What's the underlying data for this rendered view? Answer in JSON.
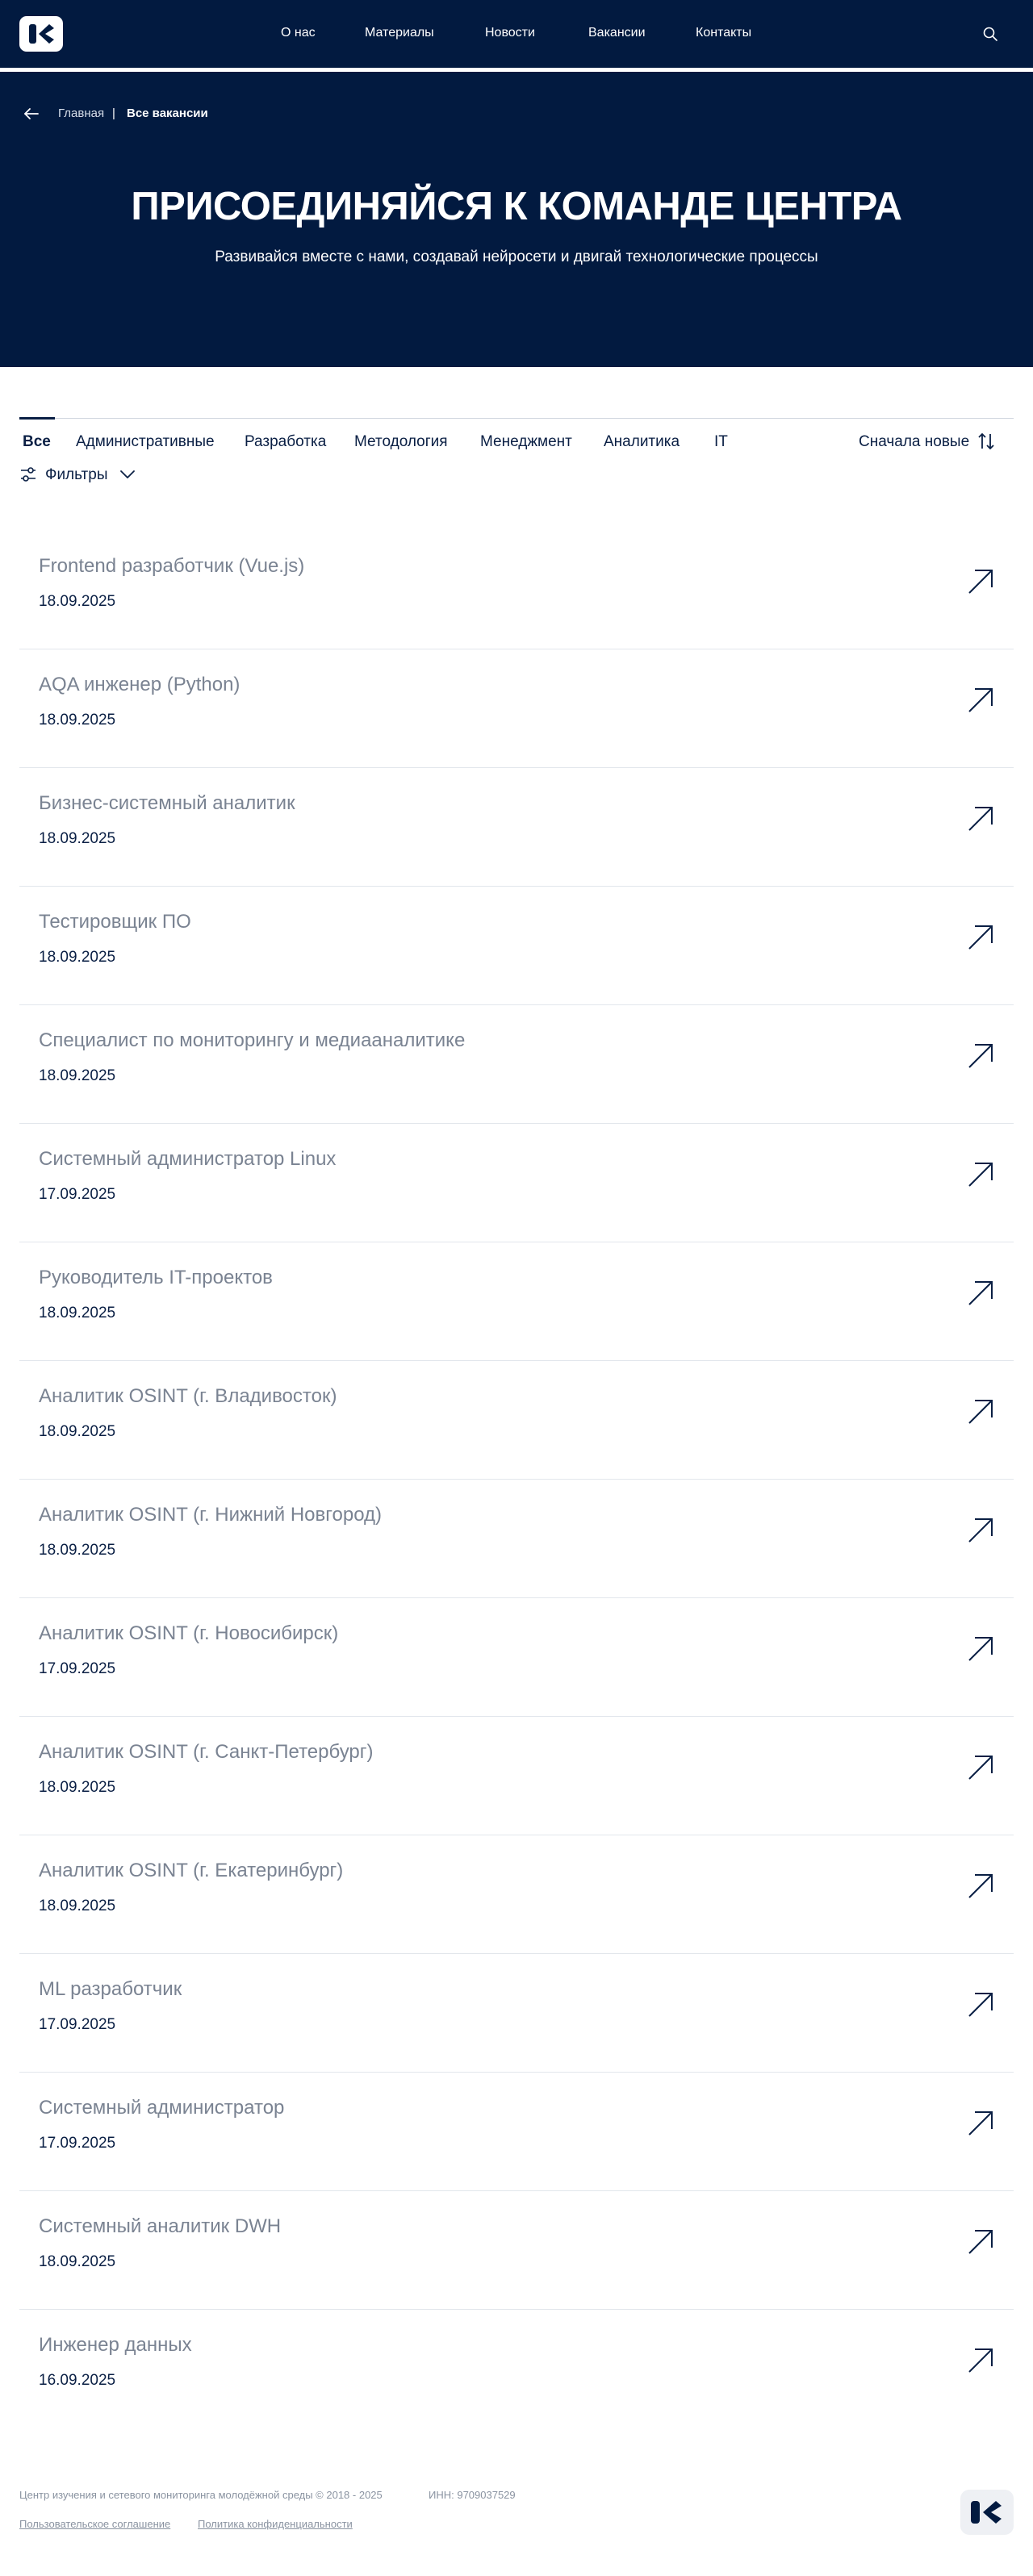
{
  "header": {
    "nav": [
      "О нас",
      "Материалы",
      "Новости",
      "Вакансии",
      "Контакты"
    ],
    "logo_icon": "company-logo-k",
    "search_icon": "search-icon",
    "background": "#021a40"
  },
  "breadcrumb": {
    "home": "Главная",
    "separator": "|",
    "current": "Все вакансии"
  },
  "hero": {
    "title": "ПРИСОЕДИНЯЙСЯ К КОМАНДЕ ЦЕНТРА",
    "subtitle": "Развивайся вместе с нами, создавай нейросети и двигай технологические процессы"
  },
  "tabs": [
    "Все",
    "Административные",
    "Разработка",
    "Методология",
    "Менеджмент",
    "Аналитика",
    "IT"
  ],
  "active_tab": "Все",
  "sort": {
    "label": "Сначала новые",
    "icon": "sort-icon"
  },
  "filters": {
    "label": "Фильтры",
    "icon": "sliders-icon"
  },
  "jobs": [
    {
      "title": "Frontend разработчик (Vue.js)",
      "date": "18.09.2025"
    },
    {
      "title": "AQA инженер (Python)",
      "date": "18.09.2025"
    },
    {
      "title": "Бизнес-системный аналитик",
      "date": "18.09.2025"
    },
    {
      "title": "Тестировщик ПО",
      "date": "18.09.2025"
    },
    {
      "title": "Специалист по мониторингу и медиааналитике",
      "date": "18.09.2025"
    },
    {
      "title": "Системный администратор Linux",
      "date": "17.09.2025"
    },
    {
      "title": "Руководитель IT-проектов",
      "date": "18.09.2025"
    },
    {
      "title": "Аналитик OSINT (г. Владивосток)",
      "date": "18.09.2025"
    },
    {
      "title": "Аналитик OSINT (г. Нижний Новгород)",
      "date": "18.09.2025"
    },
    {
      "title": "Аналитик OSINT (г. Новосибирск)",
      "date": "17.09.2025"
    },
    {
      "title": "Аналитик OSINT (г. Санкт-Петербург)",
      "date": "18.09.2025"
    },
    {
      "title": "Аналитик OSINT (г. Екатеринбург)",
      "date": "18.09.2025"
    },
    {
      "title": "ML разработчик",
      "date": "17.09.2025"
    },
    {
      "title": "Системный администратор",
      "date": "17.09.2025"
    },
    {
      "title": "Системный аналитик DWH",
      "date": "18.09.2025"
    },
    {
      "title": "Инженер данных",
      "date": "16.09.2025"
    }
  ],
  "footer": {
    "copyright": "Центр изучения и сетевого мониторинга молодёжной среды © 2018 - 2025",
    "inn": "ИНН: 9709037529",
    "links": [
      "Пользовательское соглашение",
      "Политика конфиденциальности"
    ]
  }
}
